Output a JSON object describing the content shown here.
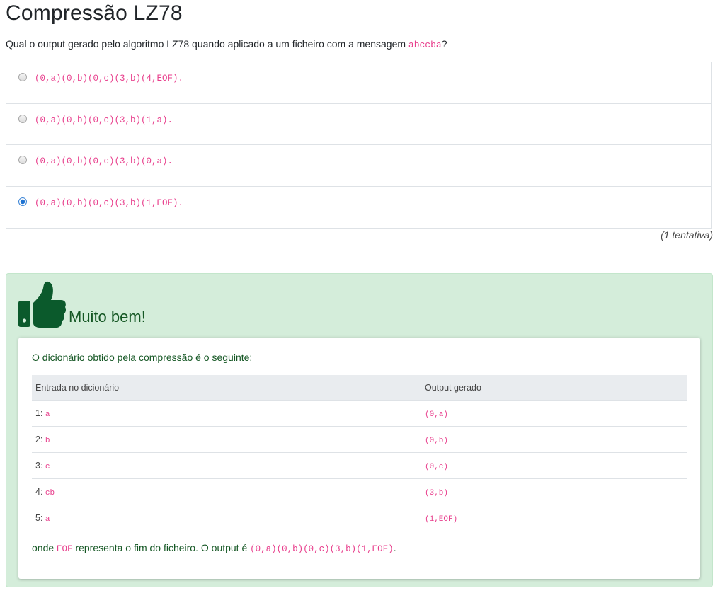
{
  "title": "Compressão LZ78",
  "question": {
    "text_before": "Qual o output gerado pelo algoritmo LZ78 quando aplicado a um ficheiro com a mensagem ",
    "message": "abccba",
    "text_after": "?"
  },
  "options": [
    {
      "code": "(0,a)(0,b)(0,c)(3,b)(4,EOF)",
      "suffix": ".",
      "selected": false
    },
    {
      "code": "(0,a)(0,b)(0,c)(3,b)(1,a)",
      "suffix": ".",
      "selected": false
    },
    {
      "code": "(0,a)(0,b)(0,c)(3,b)(0,a)",
      "suffix": ".",
      "selected": false
    },
    {
      "code": "(0,a)(0,b)(0,c)(3,b)(1,EOF)",
      "suffix": ".",
      "selected": true
    }
  ],
  "attempts": "(1 tentativa)",
  "feedback": {
    "icon": "thumbs-up-icon",
    "praise": "Muito bem!",
    "intro": "O dicionário obtido pela compressão é o seguinte:",
    "table": {
      "headers": [
        "Entrada no dicionário",
        "Output gerado"
      ],
      "rows": [
        {
          "index": "1:",
          "entry": "a",
          "output": "(0,a)"
        },
        {
          "index": "2:",
          "entry": "b",
          "output": "(0,b)"
        },
        {
          "index": "3:",
          "entry": "c",
          "output": "(0,c)"
        },
        {
          "index": "4:",
          "entry": "cb",
          "output": "(3,b)"
        },
        {
          "index": "5:",
          "entry": "a",
          "output": "(1,EOF)"
        }
      ]
    },
    "closing": {
      "prefix": "onde ",
      "eof": "EOF",
      "middle": " representa o fim do ficheiro. O output é ",
      "output": "(0,a)(0,b)(0,c)(3,b)(1,EOF)",
      "suffix": "."
    }
  },
  "colors": {
    "code": "#e83e8c",
    "success_bg": "#d4edda",
    "success_text": "#155724",
    "thumb": "#0b5a2c",
    "radio_selected": "#1e73d2"
  }
}
